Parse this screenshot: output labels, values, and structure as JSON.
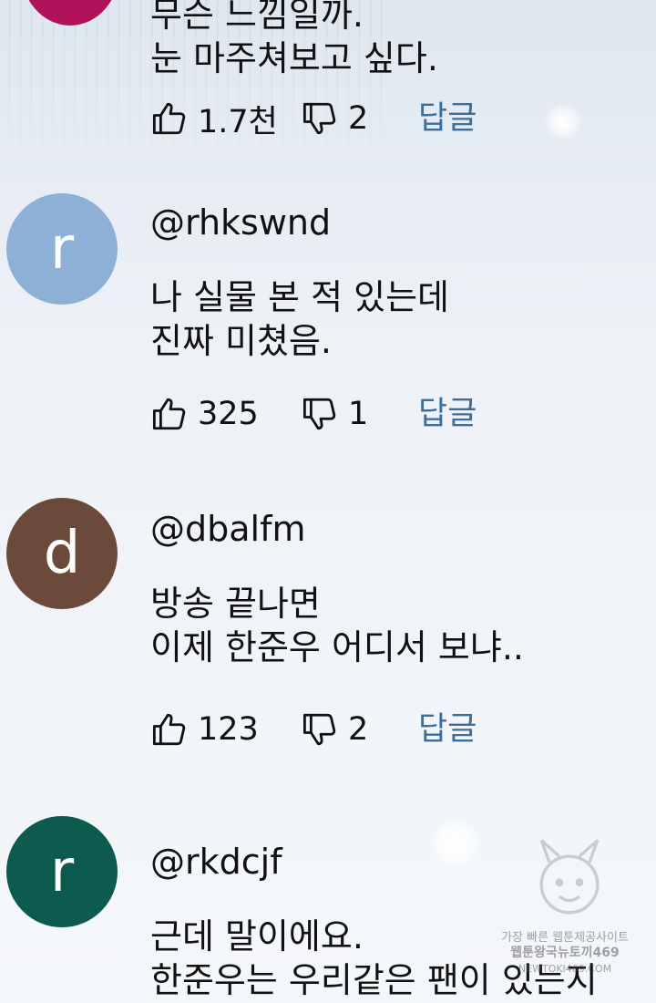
{
  "comments": [
    {
      "avatar_letter": "",
      "avatar_color": "#b0125a",
      "handle": "",
      "lines": [
        "무슨 느낌일까.",
        "눈 마주쳐보고 싶다."
      ],
      "likes": "1.7천",
      "dislikes": "2",
      "reply_label": "답글"
    },
    {
      "avatar_letter": "r",
      "avatar_color": "#8fb0d6",
      "handle": "@rhkswnd",
      "lines": [
        "나 실물 본 적 있는데",
        "진짜 미쳤음."
      ],
      "likes": "325",
      "dislikes": "1",
      "reply_label": "답글"
    },
    {
      "avatar_letter": "d",
      "avatar_color": "#6b4a3c",
      "handle": "@dbalfm",
      "lines": [
        "방송 끝나면",
        "이제 한준우 어디서 보냐.."
      ],
      "likes": "123",
      "dislikes": "2",
      "reply_label": "답글"
    },
    {
      "avatar_letter": "r",
      "avatar_color": "#0d5a4e",
      "handle": "@rkdcjf",
      "lines": [
        "근데 말이에요.",
        "한준우는 우리같은 팬이 있는지"
      ],
      "likes": "",
      "dislikes": "",
      "reply_label": ""
    }
  ],
  "watermark": {
    "line1": "가장 빠른 웹툰제공사이트",
    "line2": "웹툰왕국뉴토끼469",
    "line3": "NEWTOKI469.COM"
  },
  "icons": {
    "like": "thumbs-up-icon",
    "dislike": "thumbs-down-icon"
  }
}
